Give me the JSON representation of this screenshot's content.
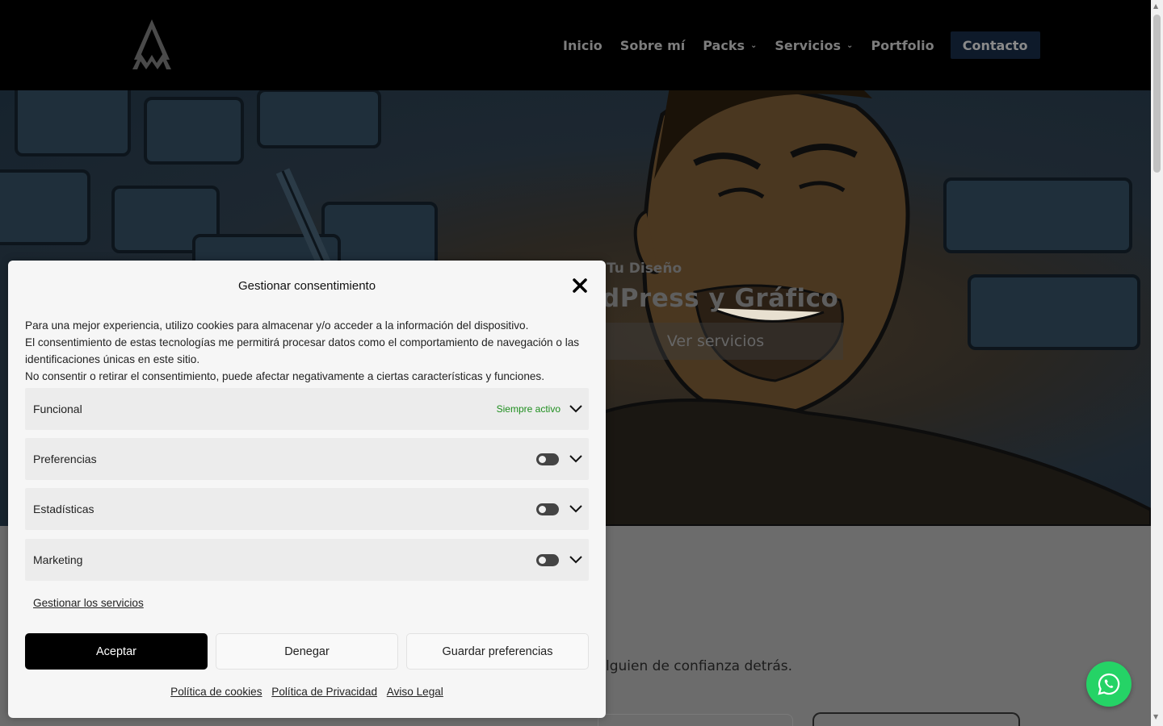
{
  "header": {
    "nav": [
      {
        "label": "Inicio",
        "has_dropdown": false
      },
      {
        "label": "Sobre mí",
        "has_dropdown": false
      },
      {
        "label": "Packs",
        "has_dropdown": true
      },
      {
        "label": "Servicios",
        "has_dropdown": true
      },
      {
        "label": "Portfolio",
        "has_dropdown": false
      }
    ],
    "cta_label": "Contacto"
  },
  "hero": {
    "subtitle": "Tu Diseño",
    "title": "dPress y Gráfico",
    "button_label": "Ver servicios"
  },
  "lower": {
    "text": "lguien de confianza detrás."
  },
  "consent": {
    "title": "Gestionar consentimiento",
    "description": [
      "Para una mejor experiencia, utilizo cookies para almacenar y/o acceder a la información del dispositivo.",
      "El consentimiento de estas tecnologías me permitirá procesar datos como el comportamiento de navegación o las identificaciones únicas en este sitio.",
      "No consentir o retirar el consentimiento, puede afectar negativamente a ciertas características y funciones."
    ],
    "categories": [
      {
        "label": "Funcional",
        "status": "Siempre activo"
      },
      {
        "label": "Preferencias",
        "enabled": false
      },
      {
        "label": "Estadísticas",
        "enabled": false
      },
      {
        "label": "Marketing",
        "enabled": false
      }
    ],
    "manage_link": "Gestionar los servicios",
    "buttons": {
      "accept": "Aceptar",
      "deny": "Denegar",
      "save": "Guardar preferencias"
    },
    "links": [
      "Política de cookies",
      "Política de Privacidad",
      "Aviso Legal"
    ]
  },
  "colors": {
    "header_bg": "#000000",
    "cta_bg": "#0e1a2a",
    "accept_bg": "#000000",
    "always_active": "#1e8e1e",
    "whatsapp": "#25d366"
  }
}
